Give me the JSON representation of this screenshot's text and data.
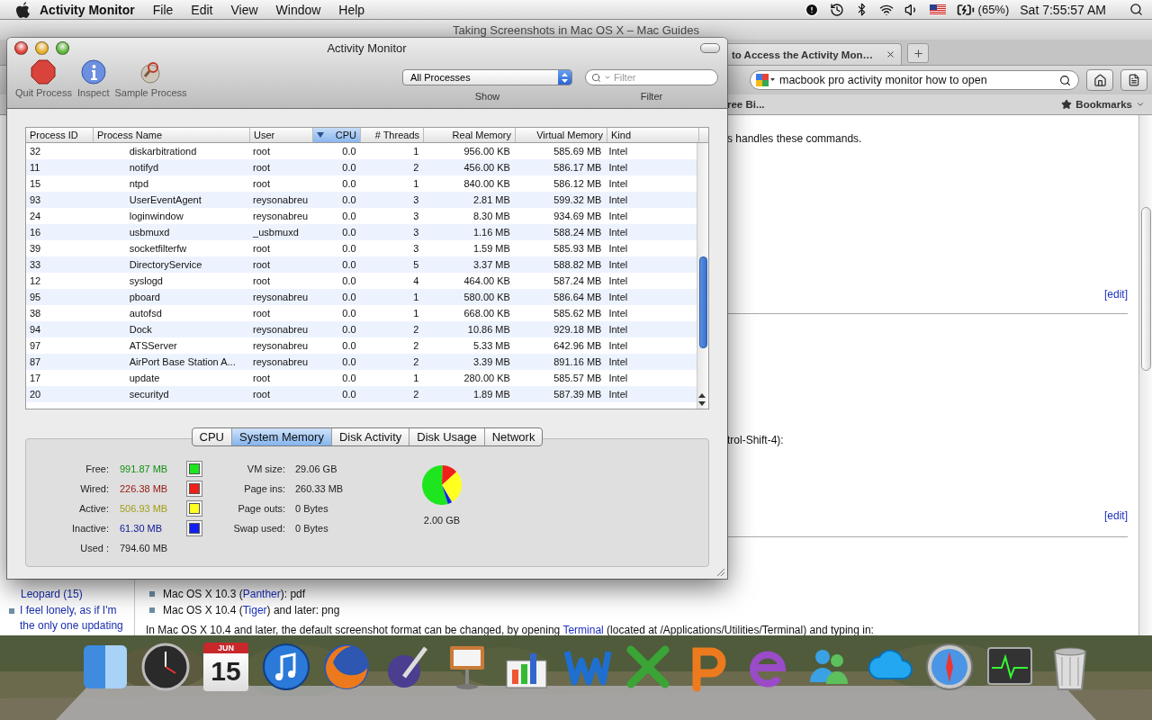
{
  "menubar": {
    "app_name": "Activity Monitor",
    "menus": [
      "File",
      "Edit",
      "View",
      "Window",
      "Help"
    ],
    "battery": "(65%)",
    "clock": "Sat 7:55:57 AM"
  },
  "browser": {
    "title": "Taking Screenshots in Mac OS X – Mac Guides",
    "tab": {
      "label": "to Access the Activity Mon…"
    },
    "search": {
      "value": "macbook pro activity monitor how to open"
    },
    "bookmarks_bar": {
      "item": "ree Bi...",
      "menu": "Bookmarks"
    },
    "sidebar": {
      "continued": "Leopard (15)",
      "items": [
        {
          "lines": [
            "I feel lonely, as if I'm",
            "the only one updating"
          ]
        }
      ]
    },
    "content": {
      "intro": "s handles these commands.",
      "edit_links": [
        "[edit]",
        "[edit]"
      ],
      "shortcut": "trol-Shift-4):",
      "list": [
        {
          "before": "Mac OS X 10.3 (",
          "link": "Panther",
          "after": "): pdf"
        },
        {
          "before": "Mac OS X 10.4 (",
          "link": "Tiger",
          "after": ") and later: png"
        }
      ],
      "paragraph": {
        "before": "In Mac OS X 10.4 and later, the default screenshot format can be changed, by opening ",
        "link": "Terminal",
        "after": " (located at /Applications/Utilities/Terminal) and typing in:"
      }
    }
  },
  "activity_monitor": {
    "title": "Activity Monitor",
    "toolbar": [
      {
        "kind": "quit",
        "label": "Quit Process"
      },
      {
        "kind": "inspect",
        "label": "Inspect"
      },
      {
        "kind": "sample",
        "label": "Sample Process"
      }
    ],
    "show": {
      "value": "All Processes",
      "label": "Show"
    },
    "filter": {
      "placeholder": "Filter",
      "label": "Filter"
    },
    "table": {
      "columns": [
        {
          "label": "Process ID",
          "sorted": false
        },
        {
          "label": "Process Name",
          "sorted": false
        },
        {
          "label": "User",
          "sorted": false
        },
        {
          "label": "CPU",
          "sorted": true
        },
        {
          "label": "# Threads",
          "sorted": false
        },
        {
          "label": "Real Memory",
          "sorted": false
        },
        {
          "label": "Virtual Memory",
          "sorted": false
        },
        {
          "label": "Kind",
          "sorted": false
        }
      ],
      "rows": [
        [
          "32",
          "diskarbitrationd",
          "root",
          "0.0",
          "1",
          "956.00 KB",
          "585.69 MB",
          "Intel"
        ],
        [
          "11",
          "notifyd",
          "root",
          "0.0",
          "2",
          "456.00 KB",
          "586.17 MB",
          "Intel"
        ],
        [
          "15",
          "ntpd",
          "root",
          "0.0",
          "1",
          "840.00 KB",
          "586.12 MB",
          "Intel"
        ],
        [
          "93",
          "UserEventAgent",
          "reysonabreu",
          "0.0",
          "3",
          "2.81 MB",
          "599.32 MB",
          "Intel"
        ],
        [
          "24",
          "loginwindow",
          "reysonabreu",
          "0.0",
          "3",
          "8.30 MB",
          "934.69 MB",
          "Intel"
        ],
        [
          "16",
          "usbmuxd",
          "_usbmuxd",
          "0.0",
          "3",
          "1.16 MB",
          "588.24 MB",
          "Intel"
        ],
        [
          "39",
          "socketfilterfw",
          "root",
          "0.0",
          "3",
          "1.59 MB",
          "585.93 MB",
          "Intel"
        ],
        [
          "33",
          "DirectoryService",
          "root",
          "0.0",
          "5",
          "3.37 MB",
          "588.82 MB",
          "Intel"
        ],
        [
          "12",
          "syslogd",
          "root",
          "0.0",
          "4",
          "464.00 KB",
          "587.24 MB",
          "Intel"
        ],
        [
          "95",
          "pboard",
          "reysonabreu",
          "0.0",
          "1",
          "580.00 KB",
          "586.64 MB",
          "Intel"
        ],
        [
          "38",
          "autofsd",
          "root",
          "0.0",
          "1",
          "668.00 KB",
          "585.62 MB",
          "Intel"
        ],
        [
          "94",
          "Dock",
          "reysonabreu",
          "0.0",
          "2",
          "10.86 MB",
          "929.18 MB",
          "Intel"
        ],
        [
          "97",
          "ATSServer",
          "reysonabreu",
          "0.0",
          "2",
          "5.33 MB",
          "642.96 MB",
          "Intel"
        ],
        [
          "87",
          "AirPort Base Station A...",
          "reysonabreu",
          "0.0",
          "2",
          "3.39 MB",
          "891.16 MB",
          "Intel"
        ],
        [
          "17",
          "update",
          "root",
          "0.0",
          "1",
          "280.00 KB",
          "585.57 MB",
          "Intel"
        ],
        [
          "20",
          "securityd",
          "root",
          "0.0",
          "2",
          "1.89 MB",
          "587.39 MB",
          "Intel"
        ]
      ]
    },
    "tabs": [
      {
        "label": "CPU",
        "selected": false
      },
      {
        "label": "System Memory",
        "selected": true
      },
      {
        "label": "Disk Activity",
        "selected": false
      },
      {
        "label": "Disk Usage",
        "selected": false
      },
      {
        "label": "Network",
        "selected": false
      }
    ],
    "memory": {
      "stats": [
        {
          "label": "Free:",
          "value": "991.87 MB",
          "color": "#1ee61e"
        },
        {
          "label": "Wired:",
          "value": "226.38 MB",
          "color": "#f02018"
        },
        {
          "label": "Active:",
          "value": "506.93 MB",
          "color": "#ffff20"
        },
        {
          "label": "Inactive:",
          "value": "61.30 MB",
          "color": "#1020f0"
        }
      ],
      "used": {
        "label": "Used :",
        "value": "794.60 MB"
      },
      "vm": [
        {
          "label": "VM size:",
          "value": "29.06 GB"
        },
        {
          "label": "Page ins:",
          "value": "260.33 MB"
        },
        {
          "label": "Page outs:",
          "value": "0 Bytes"
        },
        {
          "label": "Swap used:",
          "value": "0 Bytes"
        }
      ],
      "total": "2.00 GB"
    }
  },
  "dock": [
    {
      "kind": "split-square"
    },
    {
      "kind": "gauge"
    },
    {
      "kind": "calendar",
      "month": "JUN",
      "day": "15"
    },
    {
      "kind": "music"
    },
    {
      "kind": "globe"
    },
    {
      "kind": "pen"
    },
    {
      "kind": "lectern"
    },
    {
      "kind": "chart"
    },
    {
      "kind": "wave"
    },
    {
      "kind": "cross"
    },
    {
      "kind": "curl"
    },
    {
      "kind": "swirl"
    },
    {
      "kind": "people"
    },
    {
      "kind": "cloud"
    },
    {
      "kind": "compass"
    },
    {
      "kind": "monitor"
    },
    {
      "kind": "trash"
    }
  ]
}
